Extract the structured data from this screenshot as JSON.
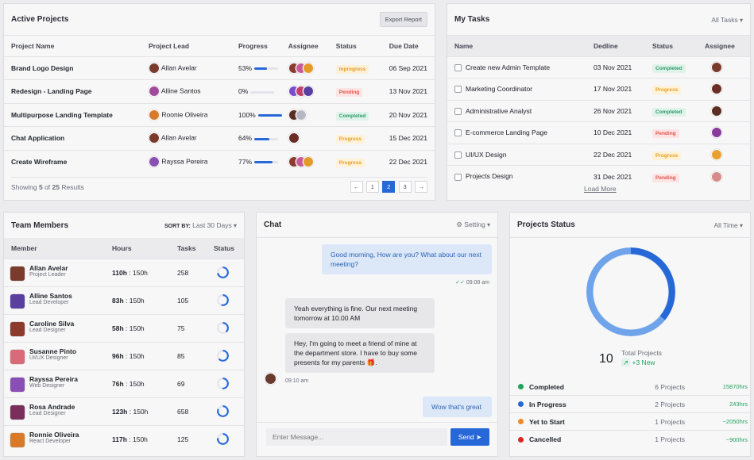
{
  "active_projects": {
    "title": "Active Projects",
    "export_label": "Export Report",
    "columns": [
      "Project Name",
      "Project Lead",
      "Progress",
      "Assignee",
      "Status",
      "Due Date"
    ],
    "rows": [
      {
        "name": "Brand Logo Design",
        "lead": "Allan Avelar",
        "progress": "53%",
        "progress_value": 0.53,
        "status": "Inprogress",
        "due": "06 Sep 2021"
      },
      {
        "name": "Redesign - Landing Page",
        "lead": "Alline Santos",
        "progress": "0%",
        "progress_value": 0,
        "status": "Pending",
        "due": "13 Nov 2021"
      },
      {
        "name": "Multipurpose Landing Template",
        "lead": "Roonie Oliveira",
        "progress": "100%",
        "progress_value": 1,
        "status": "Completed",
        "due": "20 Nov 2021"
      },
      {
        "name": "Chat Application",
        "lead": "Allan Avelar",
        "progress": "64%",
        "progress_value": 0.64,
        "status": "Progress",
        "due": "15 Dec 2021"
      },
      {
        "name": "Create Wireframe",
        "lead": "Rayssa Pereira",
        "progress": "77%",
        "progress_value": 0.77,
        "status": "Progress",
        "due": "22 Dec 2021"
      }
    ],
    "showing_prefix": "Showing ",
    "showing_shown": "5",
    "showing_mid": " of ",
    "showing_total": "25",
    "showing_suffix": " Results",
    "pagination": {
      "prev": "←",
      "pages": [
        "1",
        "2",
        "3"
      ],
      "next": "→",
      "active": "2"
    }
  },
  "my_tasks": {
    "title": "My Tasks",
    "filter": "All Tasks",
    "columns": [
      "Name",
      "Dedline",
      "Status",
      "Assignee"
    ],
    "rows": [
      {
        "name": "Create new Admin Template",
        "date": "03 Nov 2021",
        "status": "Completed"
      },
      {
        "name": "Marketing Coordinator",
        "date": "17 Nov 2021",
        "status": "Progress"
      },
      {
        "name": "Administrative Analyst",
        "date": "26 Nov 2021",
        "status": "Completed"
      },
      {
        "name": "E-commerce Landing Page",
        "date": "10 Dec 2021",
        "status": "Pending"
      },
      {
        "name": "UI/UX Design",
        "date": "22 Dec 2021",
        "status": "Progress"
      },
      {
        "name": "Projects Design",
        "date": "31 Dec 2021",
        "status": "Pending"
      }
    ],
    "load_more": "Load More"
  },
  "team": {
    "title": "Team Members",
    "sort_label": "SORT BY:",
    "sort_value": "Last 30 Days",
    "columns": [
      "Member",
      "Hours",
      "Tasks",
      "Status"
    ],
    "rows": [
      {
        "name": "Allan Avelar",
        "role": "Project Leader",
        "hours_done": "110h",
        "hours_total": "150h",
        "tasks": "258"
      },
      {
        "name": "Alline Santos",
        "role": "Lead Developer",
        "hours_done": "83h",
        "hours_total": "150h",
        "tasks": "105"
      },
      {
        "name": "Caroline Silva",
        "role": "Lead Designer",
        "hours_done": "58h",
        "hours_total": "150h",
        "tasks": "75"
      },
      {
        "name": "Susanne Pinto",
        "role": "UI/UX Designer",
        "hours_done": "96h",
        "hours_total": "150h",
        "tasks": "85"
      },
      {
        "name": "Rayssa Pereira",
        "role": "Web Designer",
        "hours_done": "76h",
        "hours_total": "150h",
        "tasks": "69"
      },
      {
        "name": "Rosa Andrade",
        "role": "Lead Designer",
        "hours_done": "123h",
        "hours_total": "150h",
        "tasks": "658"
      },
      {
        "name": "Ronnie Oliveira",
        "role": "React Developer",
        "hours_done": "117h",
        "hours_total": "150h",
        "tasks": "125"
      }
    ]
  },
  "chat": {
    "title": "Chat",
    "setting_label": "Setting",
    "messages": [
      {
        "text": "Good morning, How are you? What about our next meeting?"
      },
      {
        "time": "09:08 am"
      },
      {
        "text": "Yeah everything is fine. Our next meeting tomorrow at 10.00 AM"
      },
      {
        "text": "Hey, I'm going to meet a friend of mine at the department store. I have to buy some presents for my parents 🎁."
      },
      {
        "time": "09:10 am"
      },
      {
        "text": "Wow that's great"
      }
    ],
    "input_placeholder": "Enter Message...",
    "send_label": "Send"
  },
  "projects_status": {
    "title": "Projects Status",
    "filter": "All Time",
    "total": "10",
    "total_label": "Total Projects",
    "new_label": "+3 New",
    "legend": [
      {
        "label": "Completed",
        "projects": "6 Projects",
        "hours": "15870hrs",
        "color": "#1fa35e"
      },
      {
        "label": "In Progress",
        "projects": "2 Projects",
        "hours": "243hrs",
        "color": "#2768d8"
      },
      {
        "label": "Yet to Start",
        "projects": "1 Projects",
        "hours": "~2050hrs",
        "color": "#f08a24"
      },
      {
        "label": "Cancelled",
        "projects": "1 Projects",
        "hours": "~900hrs",
        "color": "#e02424"
      }
    ]
  },
  "colors": {
    "accent": "#2768d8",
    "green": "#1fa35e"
  }
}
